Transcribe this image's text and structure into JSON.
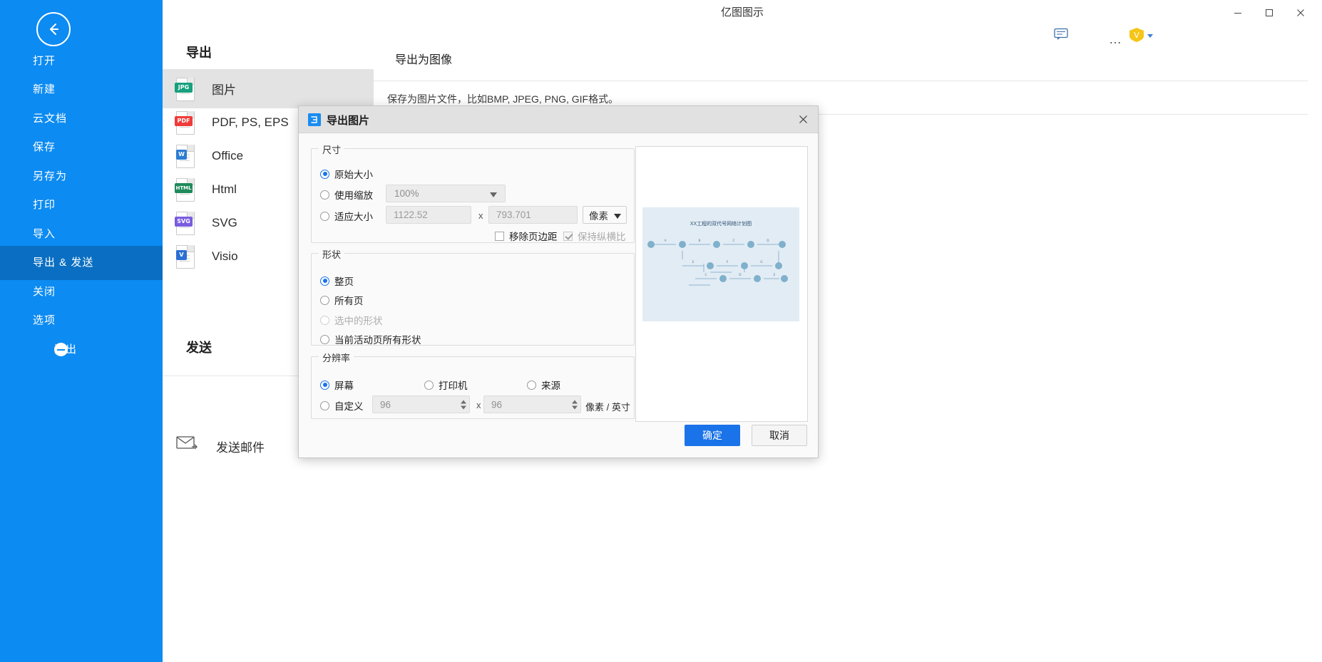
{
  "window": {
    "app_title": "亿图图示",
    "minimize": "—",
    "maximize": "▢",
    "close": "✕"
  },
  "topbar": {
    "chat_icon": "chat-icon",
    "more_icon": "…",
    "account_badge": "V"
  },
  "sidebar": {
    "back_icon": "arrow-left-icon",
    "items": [
      {
        "label": "打开",
        "active": false
      },
      {
        "label": "新建",
        "active": false
      },
      {
        "label": "云文档",
        "active": false
      },
      {
        "label": "保存",
        "active": false
      },
      {
        "label": "另存为",
        "active": false
      },
      {
        "label": "打印",
        "active": false
      },
      {
        "label": "导入",
        "active": false
      },
      {
        "label": "导出 & 发送",
        "active": true
      },
      {
        "label": "关闭",
        "active": false
      },
      {
        "label": "选项",
        "active": false
      }
    ],
    "exit": {
      "label": "退出"
    }
  },
  "export_panel": {
    "heading": "导出",
    "items": [
      {
        "label": "图片",
        "tag": "JPG",
        "color": "#17a07e",
        "selected": true
      },
      {
        "label": "PDF, PS, EPS",
        "tag": "PDF",
        "color": "#ef3b3b",
        "selected": false
      },
      {
        "label": "Office",
        "tag": "W",
        "color": "#2b7cd3",
        "selected": false
      },
      {
        "label": "Html",
        "tag": "HTML",
        "color": "#1f8a5b",
        "selected": false
      },
      {
        "label": "SVG",
        "tag": "SVG",
        "color": "#7a5ce0",
        "selected": false
      },
      {
        "label": "Visio",
        "tag": "V",
        "color": "#2b6fd3",
        "selected": false
      }
    ],
    "send_heading": "发送",
    "send_items": [
      {
        "label": "发送邮件",
        "icon": "mail-icon"
      }
    ]
  },
  "content": {
    "title": "导出为图像",
    "description": "保存为图片文件，比如BMP, JPEG, PNG, GIF格式。"
  },
  "dialog": {
    "title": "导出图片",
    "icon": "eddx-app-icon",
    "close_icon": "close-icon",
    "size_group": {
      "caption": "尺寸",
      "original": {
        "label": "原始大小",
        "selected": true
      },
      "scale": {
        "label": "使用缩放",
        "selected": false,
        "value": "100%"
      },
      "fit": {
        "label": "适应大小",
        "selected": false,
        "width": "1122.52",
        "height": "793.701",
        "separator": "x",
        "unit": "像素"
      },
      "remove_margin": {
        "label": "移除页边距",
        "checked": false,
        "disabled": false
      },
      "keep_ratio": {
        "label": "保持纵横比",
        "checked": true,
        "disabled": true
      }
    },
    "shape_group": {
      "caption": "形状",
      "options": [
        {
          "label": "整页",
          "selected": true,
          "disabled": false
        },
        {
          "label": "所有页",
          "selected": false,
          "disabled": false
        },
        {
          "label": "选中的形状",
          "selected": false,
          "disabled": true
        },
        {
          "label": "当前活动页所有形状",
          "selected": false,
          "disabled": false
        }
      ]
    },
    "resolution_group": {
      "caption": "分辨率",
      "options": [
        {
          "label": "屏幕",
          "selected": true
        },
        {
          "label": "打印机",
          "selected": false
        },
        {
          "label": "来源",
          "selected": false
        },
        {
          "label": "自定义",
          "selected": false
        }
      ],
      "dpi_x": "96",
      "dpi_y": "96",
      "separator": "x",
      "unit": "像素 / 英寸"
    },
    "preview": {
      "diagram_title": "XX工程的双代号网络计划图",
      "node_labels": [
        "A",
        "B",
        "C",
        "D",
        "E",
        "F",
        "G"
      ]
    },
    "buttons": {
      "ok": "确定",
      "cancel": "取消"
    }
  }
}
